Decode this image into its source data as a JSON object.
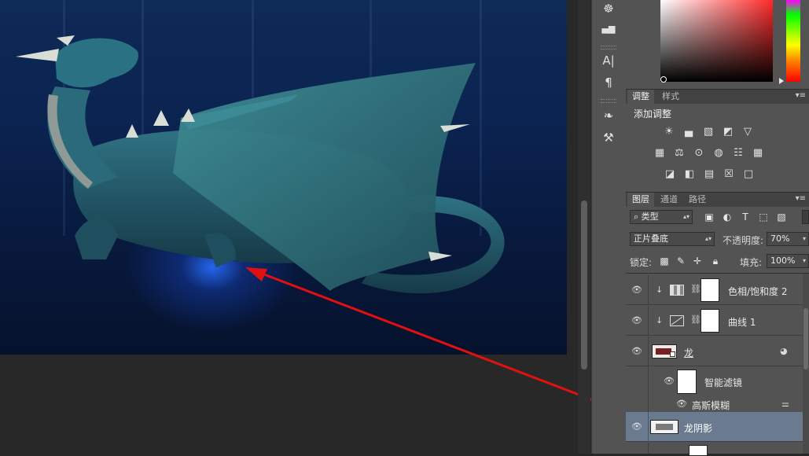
{
  "tools": {
    "items": [
      {
        "name": "navigator-icon",
        "glyph": "☸"
      },
      {
        "name": "histogram-icon",
        "glyph": "▄▆"
      },
      {
        "name": "character-icon",
        "glyph": "A|"
      },
      {
        "name": "paragraph-icon",
        "glyph": "¶"
      },
      {
        "name": "brush-preset-icon",
        "glyph": "❧"
      },
      {
        "name": "tool-preset-icon",
        "glyph": "⚒"
      }
    ]
  },
  "adjustments": {
    "tabs": [
      "调整",
      "样式"
    ],
    "add_label": "添加调整",
    "row1": [
      "☀",
      "▄",
      "▧",
      "◩",
      "▽"
    ],
    "row2": [
      "▦",
      "⚖",
      "⊙",
      "◍",
      "☷"
    ],
    "row3": [
      "◪",
      "◧",
      "▤",
      "☒",
      "□"
    ]
  },
  "layers_panel": {
    "tabs": [
      "图层",
      "通道",
      "路径"
    ],
    "filter_kind": "类型",
    "filter_icons": [
      "▣",
      "◐",
      "T",
      "⬚",
      "▧"
    ],
    "blend_mode": "正片叠底",
    "opacity_label": "不透明度:",
    "opacity_value": "70%",
    "lock_label": "锁定:",
    "lock_icons": [
      "▩",
      "✎",
      "✛",
      "✓"
    ],
    "fill_label": "填充:",
    "fill_value": "100%"
  },
  "layers": [
    {
      "name": "色相/饱和度 2",
      "type": "adjustment",
      "visible": true
    },
    {
      "name": "曲线 1",
      "type": "adjustment",
      "visible": true
    },
    {
      "name": "龙",
      "type": "smart-object",
      "visible": true
    },
    {
      "name": "智能滤镜",
      "type": "smart-filter",
      "visible": true
    },
    {
      "name": "高斯模糊",
      "type": "filter",
      "visible": true
    },
    {
      "name": "龙阴影",
      "type": "pixel",
      "visible": true,
      "selected": true
    }
  ],
  "colors": {
    "annotation_arrow": "#e01010",
    "selected_layer": "#6b7b8f",
    "panel_bg": "#535353",
    "canvas_bg": "#282828"
  }
}
